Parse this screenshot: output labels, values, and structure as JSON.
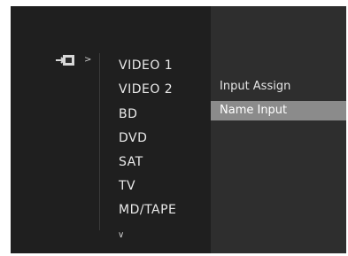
{
  "left_list": {
    "items": [
      {
        "label": "VIDEO 1"
      },
      {
        "label": "VIDEO 2"
      },
      {
        "label": "BD"
      },
      {
        "label": "DVD"
      },
      {
        "label": "SAT"
      },
      {
        "label": "TV"
      },
      {
        "label": "MD/TAPE"
      }
    ],
    "more_indicator": "∨"
  },
  "right_menu": {
    "items": [
      {
        "label": "Input Assign",
        "selected": false
      },
      {
        "label": "Name Input",
        "selected": true
      }
    ]
  },
  "header_arrow": ">",
  "icons": {
    "input": "input-icon"
  },
  "colors": {
    "background": "#1f1f1f",
    "right_pane": "#2e2e2e",
    "highlight": "#8b8b8b",
    "text": "#e9e9e9"
  }
}
